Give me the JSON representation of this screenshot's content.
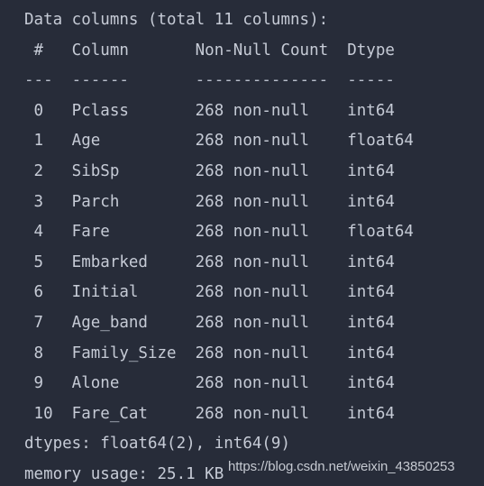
{
  "theme": {
    "background": "#272c39",
    "text_color": "#c6cbd6",
    "watermark_color": "#d3d7de"
  },
  "console": {
    "title_line": "Data columns (total 11 columns):",
    "header_line": " #   Column       Non-Null Count  Dtype ",
    "separator_line": "---  ------       --------------  ----- ",
    "columns": {
      "index_header": "#",
      "name_header": "Column",
      "count_header": "Non-Null Count",
      "dtype_header": "Dtype"
    },
    "rows": [
      {
        "index": "0",
        "name": "Pclass",
        "non_null": "268 non-null",
        "dtype": "int64",
        "line": " 0   Pclass       268 non-null    int64  "
      },
      {
        "index": "1",
        "name": "Age",
        "non_null": "268 non-null",
        "dtype": "float64",
        "line": " 1   Age          268 non-null    float64"
      },
      {
        "index": "2",
        "name": "SibSp",
        "non_null": "268 non-null",
        "dtype": "int64",
        "line": " 2   SibSp        268 non-null    int64  "
      },
      {
        "index": "3",
        "name": "Parch",
        "non_null": "268 non-null",
        "dtype": "int64",
        "line": " 3   Parch        268 non-null    int64  "
      },
      {
        "index": "4",
        "name": "Fare",
        "non_null": "268 non-null",
        "dtype": "float64",
        "line": " 4   Fare         268 non-null    float64"
      },
      {
        "index": "5",
        "name": "Embarked",
        "non_null": "268 non-null",
        "dtype": "int64",
        "line": " 5   Embarked     268 non-null    int64  "
      },
      {
        "index": "6",
        "name": "Initial",
        "non_null": "268 non-null",
        "dtype": "int64",
        "line": " 6   Initial      268 non-null    int64  "
      },
      {
        "index": "7",
        "name": "Age_band",
        "non_null": "268 non-null",
        "dtype": "int64",
        "line": " 7   Age_band     268 non-null    int64  "
      },
      {
        "index": "8",
        "name": "Family_Size",
        "non_null": "268 non-null",
        "dtype": "int64",
        "line": " 8   Family_Size  268 non-null    int64  "
      },
      {
        "index": "9",
        "name": "Alone",
        "non_null": "268 non-null",
        "dtype": "int64",
        "line": " 9   Alone        268 non-null    int64  "
      },
      {
        "index": "10",
        "name": "Fare_Cat",
        "non_null": "268 non-null",
        "dtype": "int64",
        "line": " 10  Fare_Cat     268 non-null    int64  "
      }
    ],
    "dtypes_line": "dtypes: float64(2), int64(9)",
    "memory_line": "memory usage: 25.1 KB",
    "total_columns": "11",
    "non_null_count": "268"
  },
  "watermark": {
    "text": "https://blog.csdn.net/weixin_43850253"
  }
}
